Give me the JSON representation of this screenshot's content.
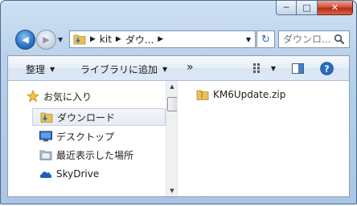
{
  "window": {
    "minimize": "─",
    "maximize": "□",
    "close": "✕"
  },
  "nav": {
    "back_icon": "◀",
    "forward_icon": "▶",
    "history_icon": "▼"
  },
  "address": {
    "crumbs": [
      "kit",
      "ダウ..."
    ],
    "separator": "▶",
    "dropdown_icon": "▼"
  },
  "refresh_icon": "↻",
  "search": {
    "placeholder": "ダウンロ..."
  },
  "toolbar": {
    "organize": "整理",
    "library": "ライブラリに追加",
    "more": "»",
    "dropdown_icon": "▼"
  },
  "sidebar": {
    "items": [
      {
        "label": "お気に入り",
        "icon": "star-icon"
      },
      {
        "label": "ダウンロード",
        "icon": "download-folder-icon",
        "selected": true
      },
      {
        "label": "デスクトップ",
        "icon": "desktop-icon"
      },
      {
        "label": "最近表示した場所",
        "icon": "recent-places-icon"
      },
      {
        "label": "SkyDrive",
        "icon": "skydrive-icon"
      }
    ]
  },
  "files": [
    {
      "name": "KM6Update.zip",
      "icon": "zip-folder-icon"
    }
  ],
  "colors": {
    "accent": "#2d77c9",
    "close": "#c93a20",
    "selection_border": "#c8d3df"
  }
}
